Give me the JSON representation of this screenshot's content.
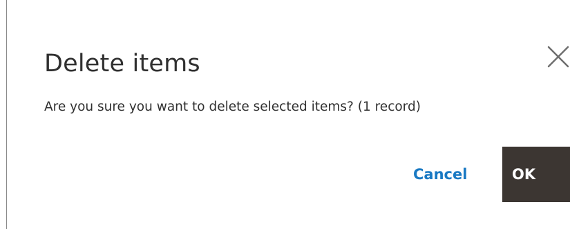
{
  "modal": {
    "title": "Delete items",
    "message": "Are you sure you want to delete selected items? (1 record)",
    "close_icon": "close-icon",
    "cancel_label": "Cancel",
    "ok_label": "OK"
  },
  "colors": {
    "cancel_text": "#1979c3",
    "ok_background": "#3c3632",
    "ok_text": "#ffffff",
    "title_text": "#303030"
  }
}
